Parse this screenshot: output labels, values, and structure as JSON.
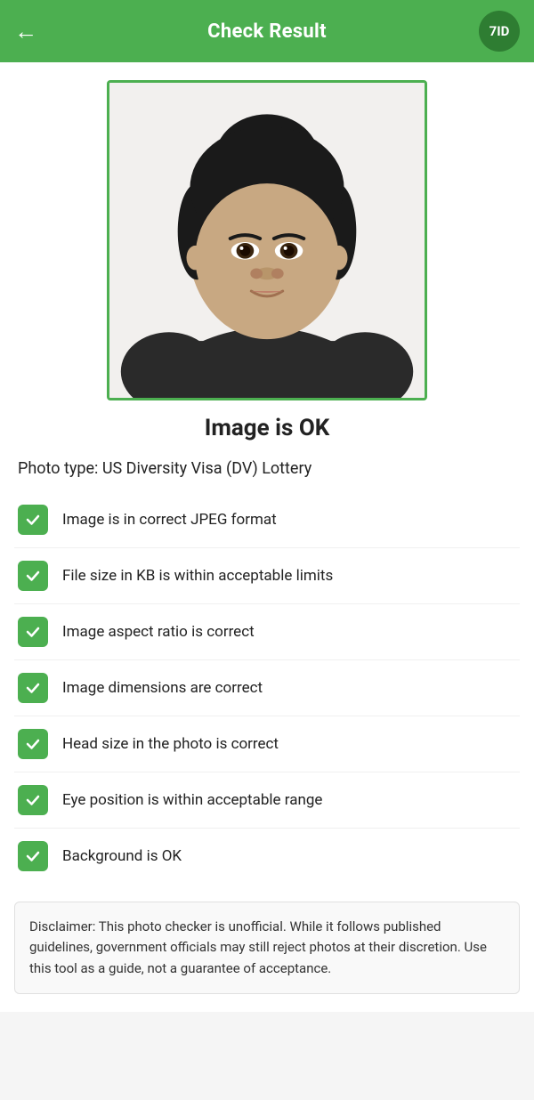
{
  "header": {
    "title": "Check Result",
    "back_arrow": "←",
    "logo_text": "7ID"
  },
  "photo": {
    "alt": "Passport photo of a young woman"
  },
  "status": {
    "title": "Image is OK"
  },
  "photo_type": {
    "label": "Photo type: US Diversity Visa (DV) Lottery"
  },
  "checks": [
    {
      "id": 1,
      "text": "Image is in correct JPEG format"
    },
    {
      "id": 2,
      "text": "File size in KB is within acceptable limits"
    },
    {
      "id": 3,
      "text": "Image aspect ratio is correct"
    },
    {
      "id": 4,
      "text": "Image dimensions are correct"
    },
    {
      "id": 5,
      "text": "Head size in the photo is correct"
    },
    {
      "id": 6,
      "text": "Eye position is within acceptable range"
    },
    {
      "id": 7,
      "text": "Background is OK"
    }
  ],
  "disclaimer": {
    "text": "Disclaimer: This photo checker is unofficial. While it follows published guidelines, government officials may still reject photos at their discretion. Use this tool as a guide, not a guarantee of acceptance."
  }
}
